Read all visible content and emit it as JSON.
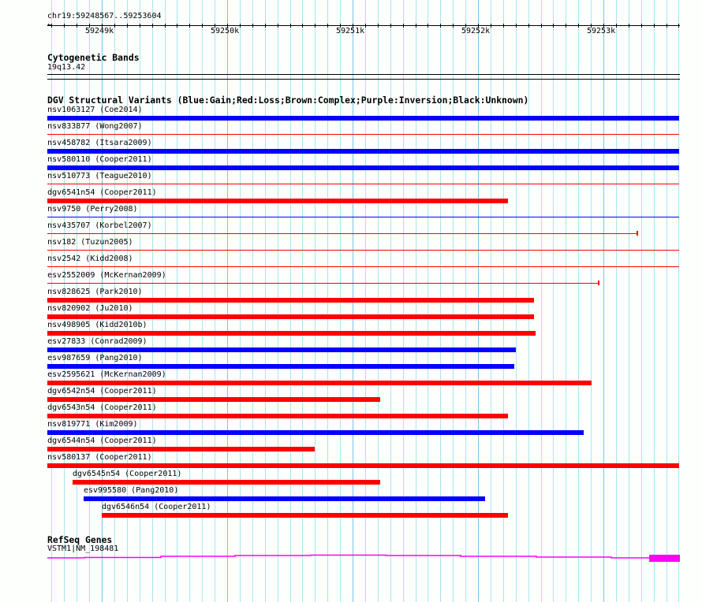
{
  "ruler": {
    "location": "chr19:59248567..59253604",
    "view_start": 59248567,
    "view_end": 59253604,
    "tick_labels": [
      {
        "pos": 59249000,
        "label": "59249k"
      },
      {
        "pos": 59250000,
        "label": "59250k"
      },
      {
        "pos": 59251000,
        "label": "59251k"
      },
      {
        "pos": 59252000,
        "label": "59252k"
      },
      {
        "pos": 59253000,
        "label": "59253k"
      }
    ]
  },
  "cytobands": {
    "title": "Cytogenetic Bands",
    "band": "19q13.42"
  },
  "dgv": {
    "title": "DGV Structural Variants (Blue:Gain;Red:Loss;Brown:Complex;Purple:Inversion;Black:Unknown)",
    "colors": {
      "gain": "#0000ff",
      "loss": "#ff0000"
    },
    "variants": [
      {
        "label": "nsv1063127 (Coe2014)",
        "type": "gain",
        "style": "thick",
        "start": 59248567,
        "end": 59253604
      },
      {
        "label": "nsv833877 (Wong2007)",
        "type": "loss",
        "style": "thin",
        "start": 59248567,
        "end": 59253604
      },
      {
        "label": "nsv458782 (Itsara2009)",
        "type": "gain",
        "style": "thick",
        "start": 59248567,
        "end": 59253604
      },
      {
        "label": "nsv580110 (Cooper2011)",
        "type": "gain",
        "style": "thick",
        "start": 59248567,
        "end": 59253604
      },
      {
        "label": "nsv510773 (Teague2010)",
        "type": "loss",
        "style": "thin",
        "start": 59248567,
        "end": 59253604
      },
      {
        "label": "dgv6541n54 (Cooper2011)",
        "type": "loss",
        "style": "thick",
        "start": 59248567,
        "end": 59252239
      },
      {
        "label": "nsv9750 (Perry2008)",
        "type": "gain",
        "style": "thin",
        "start": 59248567,
        "end": 59253604
      },
      {
        "label": "nsv435707 (Korbel2007)",
        "type": "loss",
        "style": "thin",
        "start": 59248567,
        "end": 59253270,
        "end_tick": true
      },
      {
        "label": "nsv182 (Tuzun2005)",
        "type": "loss",
        "style": "thin",
        "start": 59248567,
        "end": 59253604
      },
      {
        "label": "nsv2542 (Kidd2008)",
        "type": "loss",
        "style": "thin",
        "start": 59248567,
        "end": 59253604
      },
      {
        "label": "esv2552009 (McKernan2009)",
        "type": "loss",
        "style": "thin",
        "start": 59248567,
        "end": 59252962,
        "end_tick": true
      },
      {
        "label": "nsv828625 (Park2010)",
        "type": "loss",
        "style": "thick",
        "start": 59248567,
        "end": 59252447
      },
      {
        "label": "nsv820902 (Ju2010)",
        "type": "loss",
        "style": "thick",
        "start": 59248567,
        "end": 59252447
      },
      {
        "label": "nsv498905 (Kidd2010b)",
        "type": "loss",
        "style": "thick",
        "start": 59248567,
        "end": 59252459
      },
      {
        "label": "esv27833 (Conrad2009)",
        "type": "gain",
        "style": "thick",
        "start": 59248567,
        "end": 59252302
      },
      {
        "label": "esv987659 (Pang2010)",
        "type": "gain",
        "style": "thick",
        "start": 59248567,
        "end": 59252289
      },
      {
        "label": "esv2595621 (McKernan2009)",
        "type": "loss",
        "style": "thick",
        "start": 59248567,
        "end": 59252906
      },
      {
        "label": "dgv6542n54 (Cooper2011)",
        "type": "loss",
        "style": "thick",
        "start": 59248567,
        "end": 59251220
      },
      {
        "label": "dgv6543n54 (Cooper2011)",
        "type": "loss",
        "style": "thick",
        "start": 59248567,
        "end": 59252239
      },
      {
        "label": "nsv819771 (Kim2009)",
        "type": "gain",
        "style": "thick",
        "start": 59248567,
        "end": 59252843
      },
      {
        "label": "dgv6544n54 (Cooper2011)",
        "type": "loss",
        "style": "thick",
        "start": 59248567,
        "end": 59250698
      },
      {
        "label": "nsv580137 (Cooper2011)",
        "type": "loss",
        "style": "thick",
        "start": 59248567,
        "end": 59253604
      },
      {
        "label": "dgv6545n54 (Cooper2011)",
        "type": "loss",
        "style": "thick",
        "start": 59248767,
        "end": 59251220
      },
      {
        "label": "esv995580 (Pang2010)",
        "type": "gain",
        "style": "thick",
        "start": 59248855,
        "end": 59252057
      },
      {
        "label": "dgv6546n54 (Cooper2011)",
        "type": "loss",
        "style": "thick",
        "start": 59249000,
        "end": 59252239
      }
    ]
  },
  "refseq": {
    "title": "RefSeq Genes",
    "gene_label": "VSTM1|NM_198481",
    "color": "#ff00ff"
  }
}
